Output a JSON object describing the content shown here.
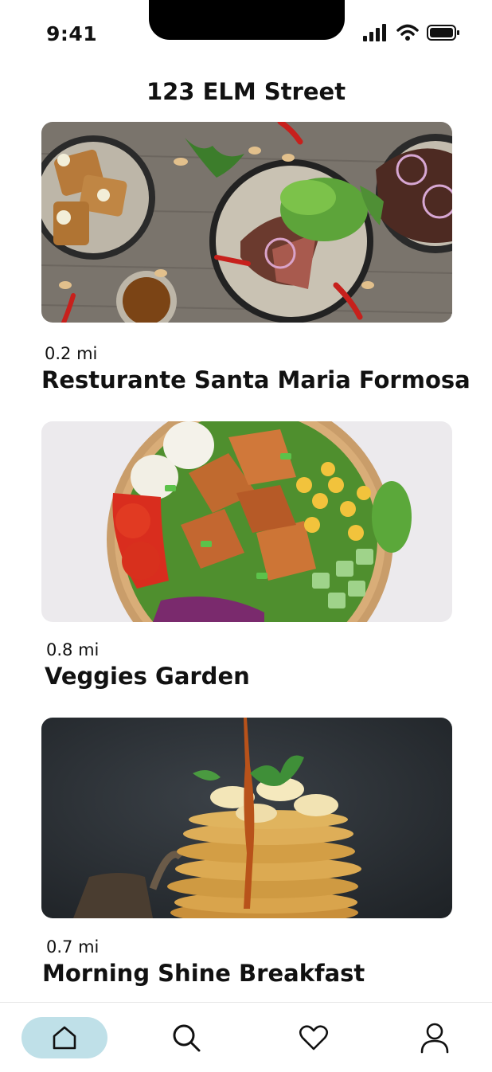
{
  "status_bar": {
    "time": "9:41"
  },
  "header": {
    "title": "123 ELM Street"
  },
  "restaurants": [
    {
      "distance": "0.2 mi",
      "name": "Resturante Santa Maria Formosa",
      "image": "plated-dishes-photo"
    },
    {
      "distance": "0.8 mi",
      "name": "Veggies Garden",
      "image": "salad-bowl-photo"
    },
    {
      "distance": "0.7 mi",
      "name": "Morning Shine Breakfast",
      "image": "pancake-stack-photo"
    }
  ],
  "tabbar": {
    "items": [
      {
        "icon": "home-icon",
        "active": true
      },
      {
        "icon": "search-icon",
        "active": false
      },
      {
        "icon": "heart-icon",
        "active": false
      },
      {
        "icon": "user-icon",
        "active": false
      }
    ],
    "active_color": "#bfe0e8"
  }
}
